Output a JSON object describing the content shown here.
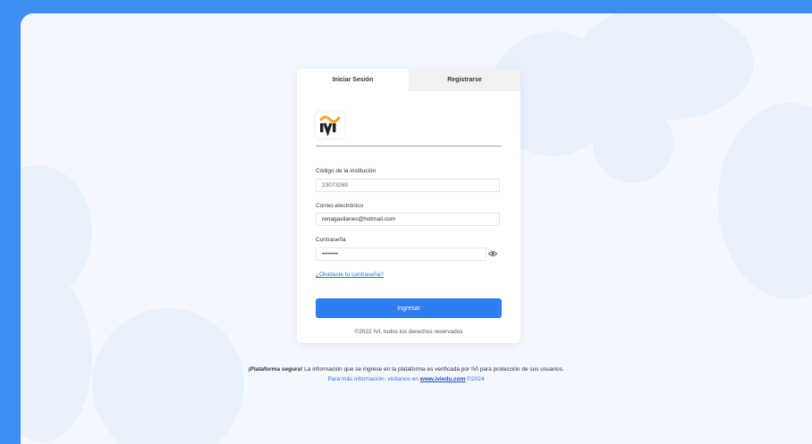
{
  "tabs": {
    "login": "Iniciar Sesión",
    "register": "Registrarse"
  },
  "logo": {
    "text": "IVI",
    "icon": "ivi-logo-icon"
  },
  "form": {
    "institution_label": "Código de la institución",
    "institution_value": "23073289",
    "email_label": "Correo electrónico",
    "email_value": "renagavilanes@hotmail.com",
    "password_label": "Contraseña",
    "password_value": "••••••••",
    "forgot_link": "¿Olvidaste tu contraseña?",
    "submit_label": "Ingresar"
  },
  "card_footer": "©2022 IVI, todos los derechos reservados",
  "footer": {
    "secure_bold": "¡Plataforma segura!",
    "secure_text": " La información que se ingrese en la plataforma es verificada por IVI para protección de sus usuarios.",
    "more_info_text": "Para más información: visítanos en ",
    "site_link": "www.iviedu.com",
    "year": " ©2024"
  },
  "colors": {
    "primary": "#2f7df0",
    "background": "#3d8ef0",
    "panel": "#f4f8fe"
  }
}
